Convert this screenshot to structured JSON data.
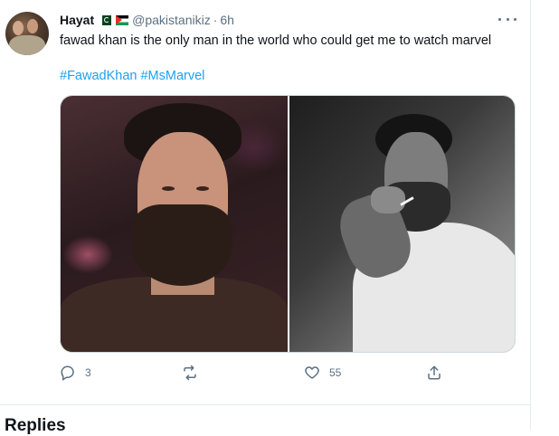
{
  "tweet": {
    "author_name": "Hayat",
    "handle": "@pakistanikiz",
    "separator": "·",
    "time": "6h",
    "text": "fawad khan is the only man in the world who could get me to watch marvel",
    "hashtags": [
      "#FawadKhan",
      "#MsMarvel"
    ],
    "flags": [
      "pakistan-flag-icon",
      "palestine-flag-icon"
    ],
    "media": [
      "photo-left",
      "photo-right"
    ]
  },
  "actions": {
    "reply_count": "3",
    "retweet_count": "",
    "like_count": "55",
    "share_count": ""
  },
  "section": {
    "replies_heading": "Replies"
  },
  "colors": {
    "accent": "#1da1f2",
    "secondary_text": "#5b7083",
    "divider": "#e6ecf0"
  }
}
